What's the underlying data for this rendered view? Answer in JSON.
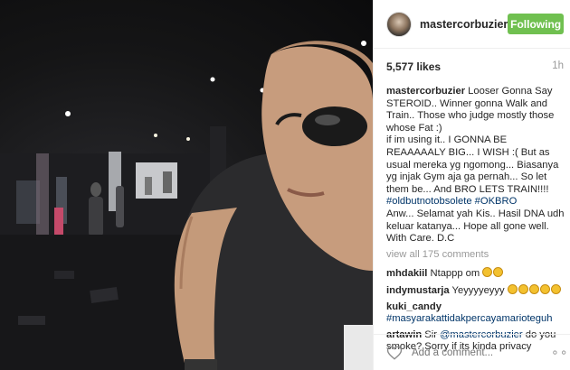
{
  "post": {
    "username": "mastercorbuzier",
    "follow_label": "Following",
    "likes": "5,577 likes",
    "age": "1h"
  },
  "caption": {
    "user": "mastercorbuzier",
    "lines": [
      "Looser Gonna Say STEROID.. Winner gonna Walk and Train.. Those who judge mostly those whose Fat :)",
      "if im using it.. I GONNA BE REAAAAALY BIG... I WISH :( But as usual mereka yg ngomong... Biasanya yg injak Gym aja ga pernah... So let them be... And BRO LETS TRAIN!!!!"
    ],
    "tags": "#oldbutnotobsolete #OKBRO",
    "tail": "Anw... Selamat yah Kis.. Hasil DNA udh keluar katanya... Hope all gone well. With Care. D.C"
  },
  "view_all": "view all 175 comments",
  "comments": [
    {
      "user": "mhdakiil",
      "text": "Ntappp om",
      "emoji_count": 2
    },
    {
      "user": "indymustarja",
      "text": "Yeyyyyeyyy",
      "emoji_count": 5
    },
    {
      "user": "kuki_candy",
      "text": "",
      "tag": "#masyarakattidakpercayamarioteguh"
    },
    {
      "user": "artawin",
      "text_before": "Sir ",
      "mention": "@mastercorbuzier",
      "text_after": " do you smoke? Sorry if its kinda privacy"
    }
  ],
  "add_comment_placeholder": "Add a comment...",
  "icons": {
    "like": "heart-icon",
    "more": "more-options-icon"
  },
  "colors": {
    "follow_button": "#70c050",
    "tag_link": "#003569"
  }
}
